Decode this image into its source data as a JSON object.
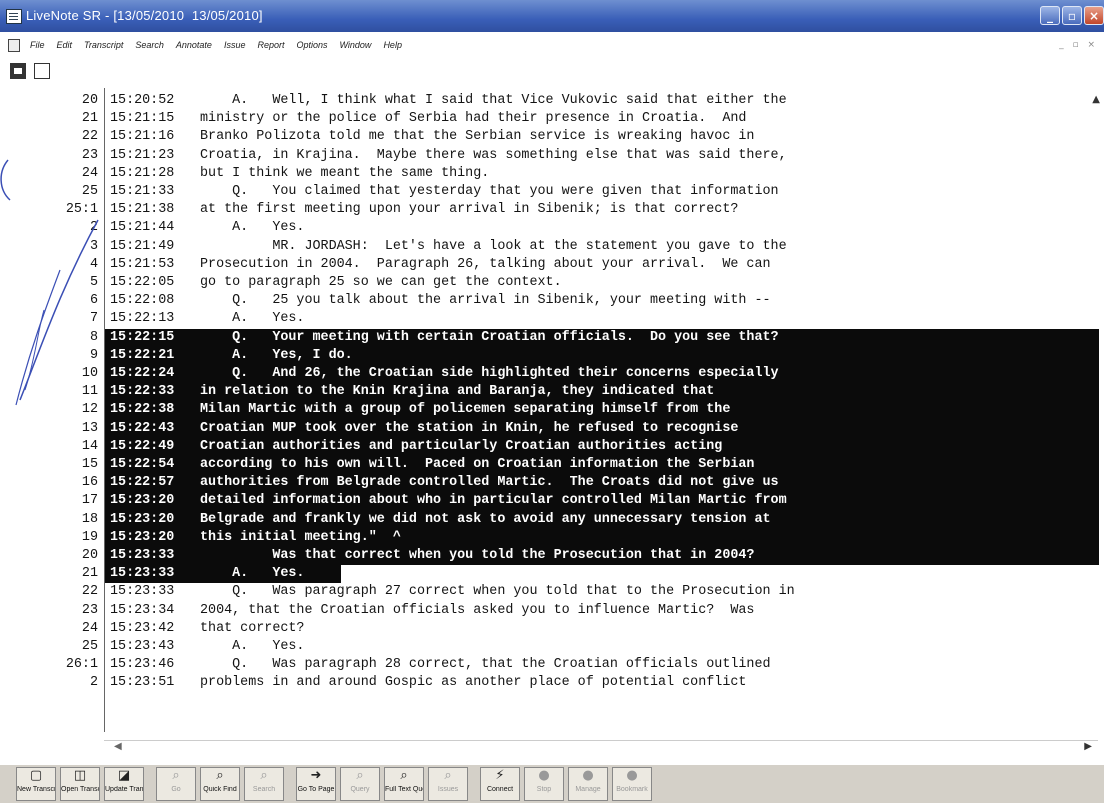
{
  "window": {
    "title": "LiveNote SR - [13/05/2010  13/05/2010]",
    "controls": [
      "minimize",
      "maximize",
      "close"
    ]
  },
  "menu": {
    "items": [
      "File",
      "Edit",
      "Transcript",
      "Search",
      "Annotate",
      "Issue",
      "Report",
      "Options",
      "Window",
      "Help"
    ]
  },
  "transcript": {
    "lines": [
      {
        "num": "20",
        "time": "15:20:52",
        "text": "    A.   Well, I think what I said that Vice Vukovic said that either the",
        "hl": false
      },
      {
        "num": "21",
        "time": "15:21:15",
        "text": "ministry or the police of Serbia had their presence in Croatia.  And",
        "hl": false
      },
      {
        "num": "22",
        "time": "15:21:16",
        "text": "Branko Polizota told me that the Serbian service is wreaking havoc in",
        "hl": false
      },
      {
        "num": "23",
        "time": "15:21:23",
        "text": "Croatia, in Krajina.  Maybe there was something else that was said there,",
        "hl": false
      },
      {
        "num": "24",
        "time": "15:21:28",
        "text": "but I think we meant the same thing.",
        "hl": false
      },
      {
        "num": "25",
        "time": "15:21:33",
        "text": "    Q.   You claimed that yesterday that you were given that information",
        "hl": false
      },
      {
        "num": "25:1",
        "time": "15:21:38",
        "text": "at the first meeting upon your arrival in Sibenik; is that correct?",
        "hl": false
      },
      {
        "num": "2",
        "time": "15:21:44",
        "text": "    A.   Yes.",
        "hl": false
      },
      {
        "num": "3",
        "time": "15:21:49",
        "text": "         MR. JORDASH:  Let's have a look at the statement you gave to the",
        "hl": false
      },
      {
        "num": "4",
        "time": "15:21:53",
        "text": "Prosecution in 2004.  Paragraph 26, talking about your arrival.  We can",
        "hl": false
      },
      {
        "num": "5",
        "time": "15:22:05",
        "text": "go to paragraph 25 so we can get the context.",
        "hl": false
      },
      {
        "num": "6",
        "time": "15:22:08",
        "text": "    Q.   25 you talk about the arrival in Sibenik, your meeting with --",
        "hl": false
      },
      {
        "num": "7",
        "time": "15:22:13",
        "text": "    A.   Yes.",
        "hl": false
      },
      {
        "num": "8",
        "time": "15:22:15",
        "text": "    Q.   Your meeting with certain Croatian officials.  Do you see that?",
        "hl": true
      },
      {
        "num": "9",
        "time": "15:22:21",
        "text": "    A.   Yes, I do.",
        "hl": true
      },
      {
        "num": "10",
        "time": "15:22:24",
        "text": "    Q.   And 26, the Croatian side highlighted their concerns especially",
        "hl": true
      },
      {
        "num": "11",
        "time": "15:22:33",
        "text": "in relation to the Knin Krajina and Baranja, they indicated that",
        "hl": true
      },
      {
        "num": "12",
        "time": "15:22:38",
        "text": "Milan Martic with a group of policemen separating himself from the",
        "hl": true
      },
      {
        "num": "13",
        "time": "15:22:43",
        "text": "Croatian MUP took over the station in Knin, he refused to recognise",
        "hl": true
      },
      {
        "num": "14",
        "time": "15:22:49",
        "text": "Croatian authorities and particularly Croatian authorities acting",
        "hl": true
      },
      {
        "num": "15",
        "time": "15:22:54",
        "text": "according to his own will.  Paced on Croatian information the Serbian",
        "hl": true
      },
      {
        "num": "16",
        "time": "15:22:57",
        "text": "authorities from Belgrade controlled Martic.  The Croats did not give us",
        "hl": true
      },
      {
        "num": "17",
        "time": "15:23:20",
        "text": "detailed information about who in particular controlled Milan Martic from",
        "hl": true
      },
      {
        "num": "18",
        "time": "15:23:20",
        "text": "Belgrade and frankly we did not ask to avoid any unnecessary tension at",
        "hl": true
      },
      {
        "num": "19",
        "time": "15:23:20",
        "text": "this initial meeting.\"  ^",
        "hl": true
      },
      {
        "num": "20",
        "time": "15:23:33",
        "text": "         Was that correct when you told the Prosecution that in 2004?",
        "hl": true
      },
      {
        "num": "21",
        "time": "15:23:33",
        "text": "    A.   Yes.",
        "hl": true
      },
      {
        "num": "22",
        "time": "15:23:33",
        "text": "    Q.   Was paragraph 27 correct when you told that to the Prosecution in",
        "hl": false
      },
      {
        "num": "23",
        "time": "15:23:34",
        "text": "2004, that the Croatian officials asked you to influence Martic?  Was",
        "hl": false
      },
      {
        "num": "24",
        "time": "15:23:42",
        "text": "that correct?",
        "hl": false
      },
      {
        "num": "25",
        "time": "15:23:43",
        "text": "    A.   Yes.",
        "hl": false
      },
      {
        "num": "26:1",
        "time": "15:23:46",
        "text": "    Q.   Was paragraph 28 correct, that the Croatian officials outlined",
        "hl": false
      },
      {
        "num": "2",
        "time": "15:23:51",
        "text": "problems in and around Gospic as another place of potential conflict",
        "hl": false
      }
    ]
  },
  "toolbar": {
    "buttons": [
      {
        "label": "New Transcript",
        "icon": "new-doc-icon",
        "glyph": "▢",
        "enabled": true
      },
      {
        "label": "Open Transcript",
        "icon": "open-doc-icon",
        "glyph": "◫",
        "enabled": true
      },
      {
        "label": "Update Transcript",
        "icon": "update-doc-icon",
        "glyph": "◪",
        "enabled": true
      },
      {
        "label": "Go",
        "icon": "search-icon",
        "glyph": "⌕",
        "enabled": false
      },
      {
        "label": "Quick Find",
        "icon": "quick-find-icon",
        "glyph": "⌕",
        "enabled": true
      },
      {
        "label": "Search",
        "icon": "search-list-icon",
        "glyph": "⌕",
        "enabled": false
      },
      {
        "label": "Go To Page",
        "icon": "goto-page-icon",
        "glyph": "➜",
        "enabled": true
      },
      {
        "label": "Query",
        "icon": "query-icon",
        "glyph": "⌕",
        "enabled": false
      },
      {
        "label": "Full Text Query",
        "icon": "full-text-query-icon",
        "glyph": "⌕",
        "enabled": true
      },
      {
        "label": "Issues",
        "icon": "issues-icon",
        "glyph": "⌕",
        "enabled": false
      },
      {
        "label": "Connect",
        "icon": "connect-icon",
        "glyph": "⚡",
        "enabled": true
      },
      {
        "label": "Stop",
        "icon": "stop-icon",
        "glyph": "●",
        "enabled": false
      },
      {
        "label": "Manage",
        "icon": "manage-icon",
        "glyph": "●",
        "enabled": false
      },
      {
        "label": "Bookmark",
        "icon": "bookmark-icon",
        "glyph": "●",
        "enabled": false
      }
    ]
  },
  "colors": {
    "titlebar": "#3a5fb8",
    "highlight": "#0b0b0b",
    "pen": "#3b4fb5"
  }
}
